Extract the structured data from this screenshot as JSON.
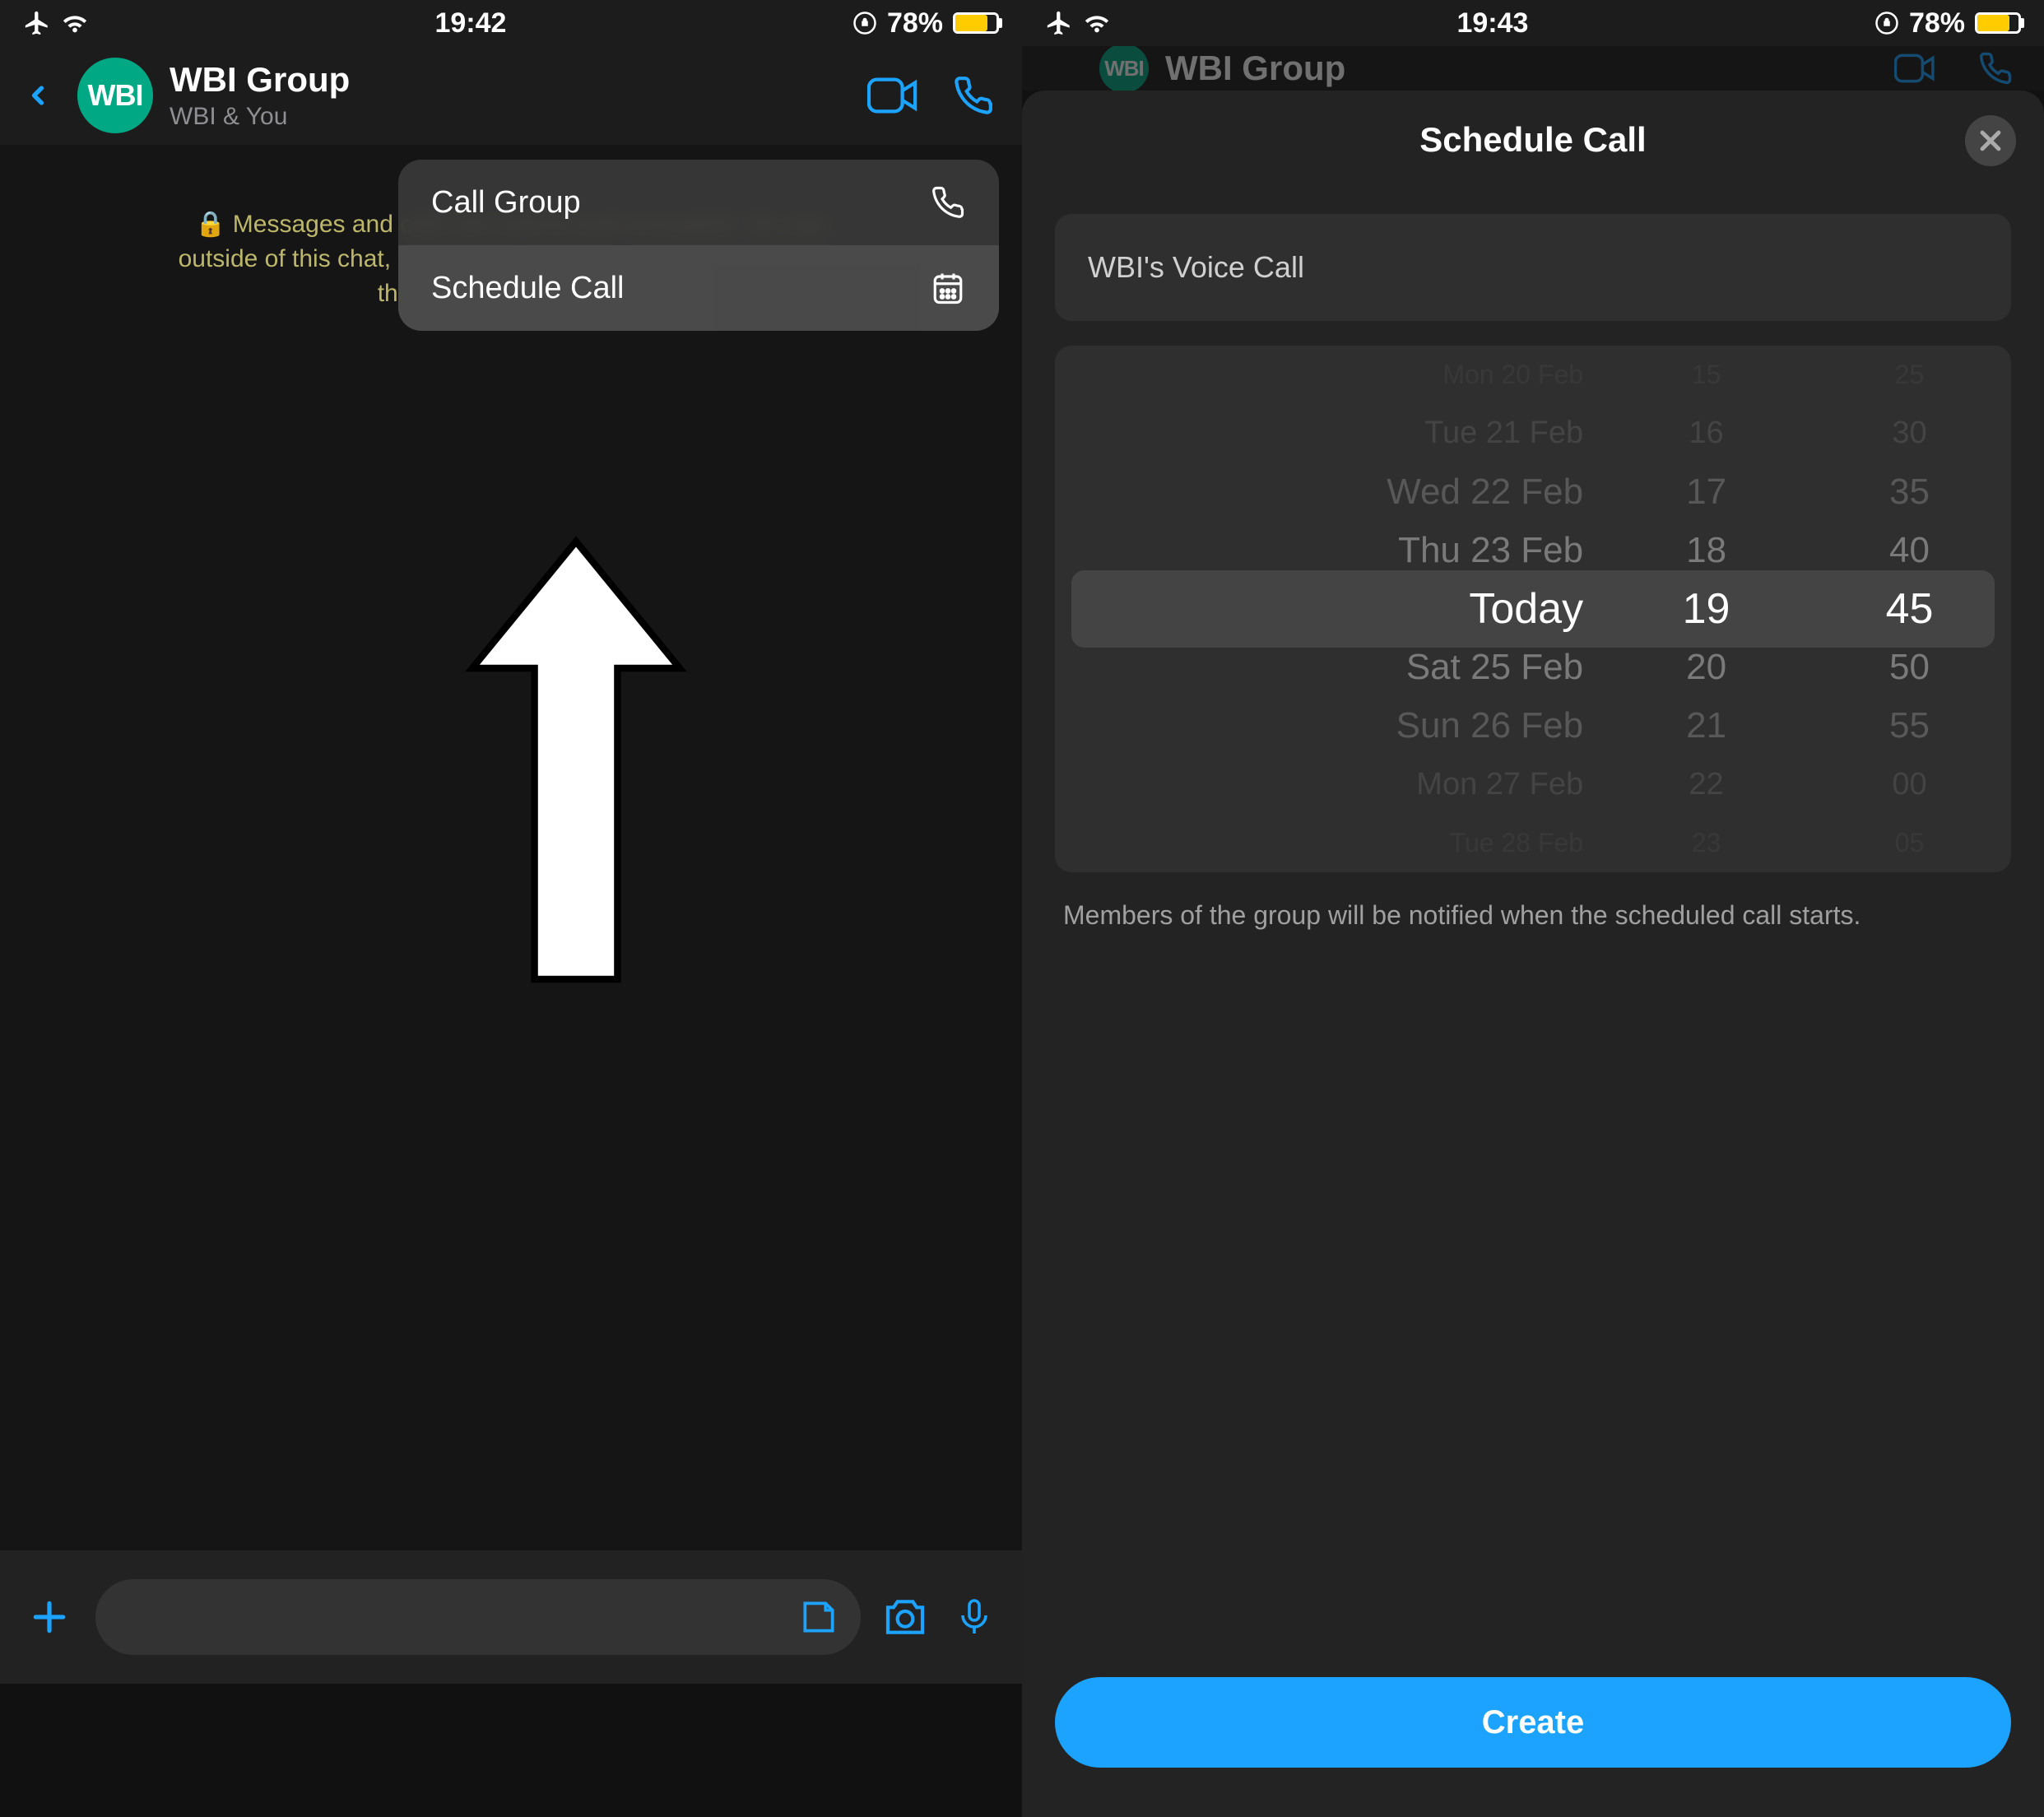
{
  "status": {
    "time_left": "19:42",
    "time_right": "19:43",
    "battery": "78%"
  },
  "group": {
    "title": "WBI Group",
    "subtitle": "WBI & You",
    "avatar": "WBI"
  },
  "encryption": "Messages and calls are end-to-end encrypted. No one outside of this chat, not even WhatsApp, can read or listen to them. Tap to learn more.",
  "encryption_cropped": "Messages and calls are end-to-end encrypted.\nNo one outside of this chat, not even WhatsApp,\ncan read or listen to them. Tap to learn more.",
  "menu": {
    "item1": "Call Group",
    "item2": "Schedule Call"
  },
  "sheet": {
    "title": "Schedule Call",
    "call_name": "WBI's Voice Call",
    "info": "Members of the group will be notified when the scheduled call starts.",
    "create": "Create"
  },
  "picker": {
    "dates": [
      "Mon 20 Feb",
      "Tue 21 Feb",
      "Wed 22 Feb",
      "Thu 23 Feb",
      "Today",
      "Sat 25 Feb",
      "Sun 26 Feb",
      "Mon 27 Feb",
      "Tue 28 Feb"
    ],
    "hours": [
      "15",
      "16",
      "17",
      "18",
      "19",
      "20",
      "21",
      "22",
      "23"
    ],
    "mins": [
      "25",
      "30",
      "35",
      "40",
      "45",
      "50",
      "55",
      "00",
      "05"
    ]
  }
}
